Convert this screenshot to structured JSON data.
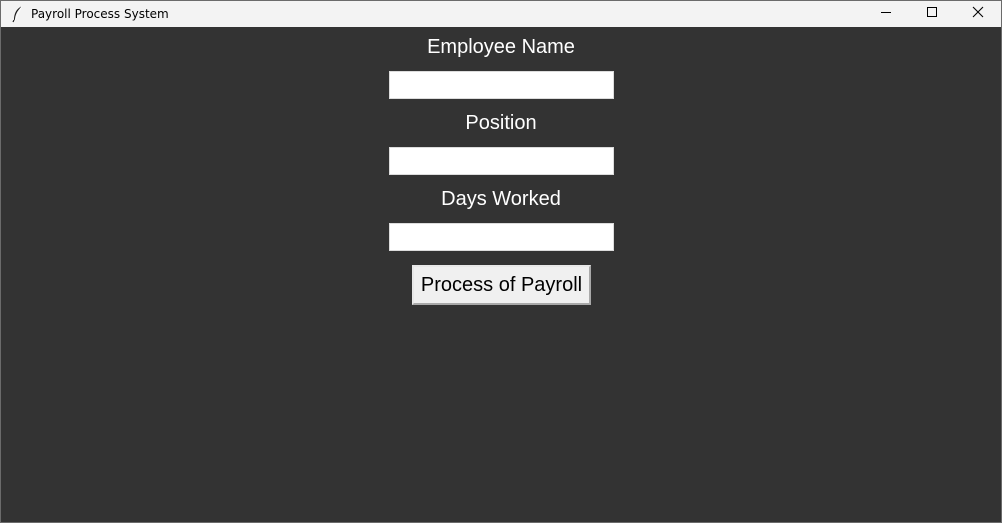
{
  "window": {
    "title": "Payroll Process System",
    "app_icon": "feather-icon",
    "controls": {
      "minimize_icon": "minimize-icon",
      "maximize_icon": "maximize-icon",
      "close_icon": "close-icon"
    }
  },
  "form": {
    "employee_name_label": "Employee Name",
    "employee_name_value": "",
    "position_label": "Position",
    "position_value": "",
    "days_worked_label": "Days Worked",
    "days_worked_value": "",
    "process_button_label": "Process of Payroll"
  },
  "colors": {
    "background": "#333333",
    "label_text": "#ffffff",
    "titlebar": "#f3f3f3",
    "button_face": "#f0f0f0"
  }
}
